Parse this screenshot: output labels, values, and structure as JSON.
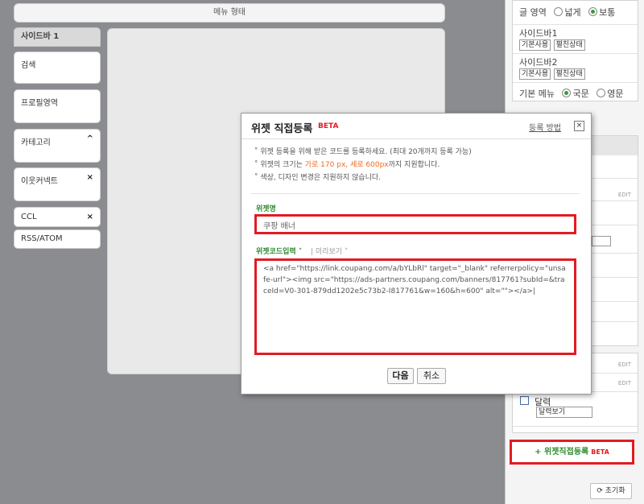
{
  "layout_bar": {
    "label": "메뉴 형태"
  },
  "sidebar1": {
    "title": "사이드바 1",
    "items": [
      {
        "label": "검색",
        "mark": ""
      },
      {
        "label": "프로필영역",
        "mark": ""
      },
      {
        "label": "카테고리",
        "mark": "^"
      },
      {
        "label": "이웃커넥트",
        "mark": "×"
      },
      {
        "label": "CCL",
        "mark": "×"
      },
      {
        "label": "RSS/ATOM",
        "mark": ""
      }
    ]
  },
  "settings": {
    "text_area_label": "글 영역",
    "wide_label": "넓게",
    "normal_label": "보통",
    "sidebar1_label": "사이드바1",
    "sidebar2_label": "사이드바2",
    "use_select": "기본사용",
    "state_select": "펼친상태",
    "base_menu_label": "기본 메뉴",
    "korean_label": "국문",
    "english_label": "영문"
  },
  "widget_list": {
    "edit_label": "EDIT",
    "calendar_label": "달력",
    "calendar_select": "달력보기"
  },
  "add_widget": {
    "plus": "+",
    "label": "위젯직접등록",
    "beta": "BETA"
  },
  "reset": {
    "label": "초기화"
  },
  "dialog": {
    "title": "위젯 직접등록",
    "beta": "BETA",
    "help": "등록 방법",
    "close": "×",
    "note1": "˚ 위젯 등록을 위해 받은 코드를 등록하세요. (최대 20개까지 등록 가능)",
    "note2_pre": "˚ 위젯의 크기는 ",
    "note2_hl": "가로 170 px, 세로 600px",
    "note2_post": "까지 지원합니다.",
    "note3": "˚ 색상, 디자인 변경은 지원하지 않습니다.",
    "name_label": "위젯명",
    "name_value": "쿠팡 배너",
    "code_label": "위젯코드입력",
    "preview_label": "미리보기",
    "code_value": "<a href=\"https://link.coupang.com/a/bYLbRl\" target=\"_blank\" referrerpolicy=\"unsafe-url\"><img src=\"https://ads-partners.coupang.com/banners/817761?subId=&traceId=V0-301-879dd1202e5c73b2-I817761&w=160&h=600\" alt=\"\"></a>|",
    "next_button": "다음",
    "cancel_button": "취소"
  }
}
